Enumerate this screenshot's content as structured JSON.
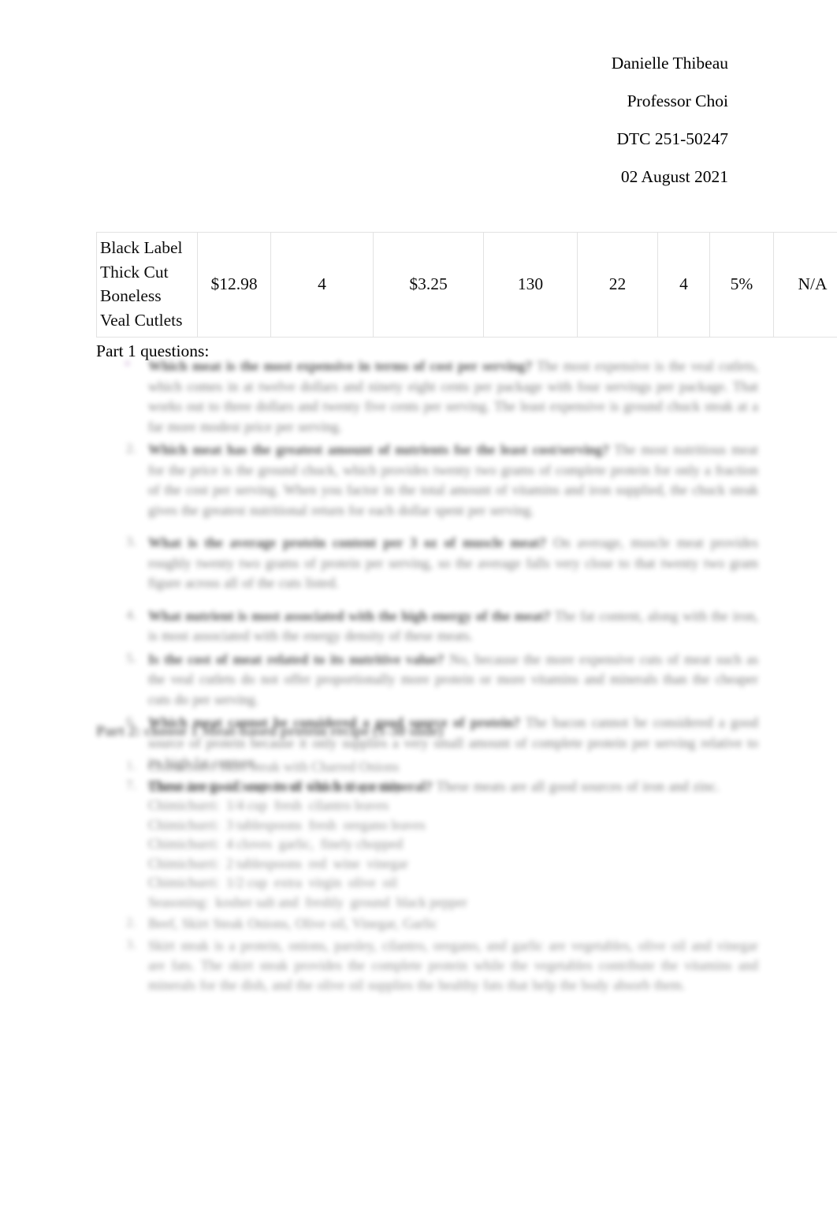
{
  "document": {
    "header": {
      "lines": [
        "Danielle Thibeau",
        "Professor Choi",
        "DTC 251-50247",
        "02 August 2021"
      ]
    },
    "table": {
      "rows": [
        {
          "cells": [
            "Black Label Thick Cut Boneless Veal Cutlets",
            "$12.98",
            "4",
            "$3.25",
            "130",
            "22",
            "4",
            "5%",
            "N/A"
          ]
        }
      ]
    },
    "part1": {
      "heading": "Part 1 questions:",
      "questions": [
        {
          "marker": "▪",
          "marker_style": "bullet-purple",
          "bold_prompt": "Which meat is the most expensive in terms of cost per serving?",
          "answer": "The most expensive is the veal cutlets, which comes in at twelve dollars and ninety eight cents per package with four servings per package. That works out to three dollars and twenty five cents per serving. The least expensive is ground chuck steak at a far more modest price per serving."
        },
        {
          "marker": "2.",
          "marker_style": "numeric",
          "bold_prompt": "Which meat has the greatest amount of nutrients for the least cost/serving?",
          "answer": "The most nutritious meat for the price is the ground chuck, which provides twenty two grams of complete protein for only a fraction of the cost per serving. When you factor in the total amount of vitamins and iron supplied, the chuck steak gives the greatest nutritional return for each dollar spent per serving."
        },
        {
          "marker": "3.",
          "marker_style": "numeric",
          "bold_prompt": "What is the average protein content per 3 oz of muscle meat?",
          "answer": "On average, muscle meat provides roughly twenty two grams of protein per serving, so the average falls very close to that twenty two gram figure across all of the cuts listed."
        },
        {
          "marker": "4.",
          "marker_style": "numeric",
          "bold_prompt": "What nutrient is most associated with the high energy of the meat?",
          "answer": "The fat content, along with the iron, is most associated with the energy density of these meats."
        },
        {
          "marker": "5.",
          "marker_style": "numeric",
          "bold_prompt": "Is the cost of meat related to its nutritive value?",
          "answer": "No, because the more expensive cuts of meat such as the veal cutlets do not offer proportionally more protein or more vitamins and minerals than the cheaper cuts do per serving."
        },
        {
          "marker": "6.",
          "marker_style": "numeric",
          "bold_prompt": "Which meat cannot be considered a good source of protein?",
          "answer": "The bacon cannot be considered a good source of protein because it only supplies a very small amount of complete protein per serving relative to its high fat content."
        },
        {
          "marker": "7.",
          "marker_style": "numeric",
          "bold_prompt": "These are good sources of which trace mineral?",
          "answer": "These meats are all good sources of iron and zinc."
        }
      ]
    },
    "part2": {
      "heading": "Part 2: choose 1 Meat-based protein recipe (1-30 slide)",
      "items": [
        {
          "marker": "1.",
          "lines": [
            "Chimichurri Skirt Steak with Charred Onions",
            "Chimichurri:  1/2 cup  fresh  flat  leaf  parsley",
            "Chimichurri:  1/4 cup  fresh  cilantro leaves",
            "Chimichurri:  3 tablespoons  fresh  oregano leaves",
            "Chimichurri:  4 cloves  garlic,  finely chopped",
            "Chimichurri:  2 tablespoons  red  wine  vinegar",
            "Chimichurri:  1/2 cup  extra  virgin  olive  oil",
            "Seasoning:  kosher salt and  freshly  ground  black pepper"
          ]
        },
        {
          "marker": "2.",
          "text": "Beef,  Skirt Steak  Onions,  Olive oil,  Vinegar,  Garlic"
        },
        {
          "marker": "3.",
          "text": "Skirt steak is a protein, onions, parsley, cilantro, oregano, and garlic are vegetables, olive oil and vinegar are fats. The skirt steak provides the complete protein while the vegetables contribute the vitamins and minerals for the dish, and the olive oil supplies the healthy fats that help the body absorb them."
        }
      ]
    }
  }
}
